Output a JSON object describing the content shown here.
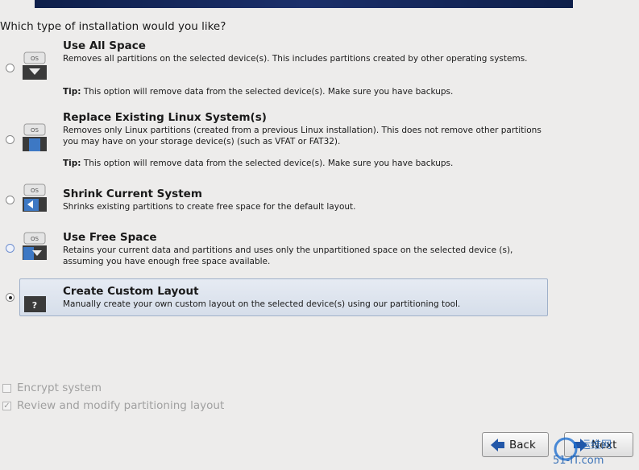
{
  "question": "Which type of installation would you like?",
  "options": [
    {
      "title": "Use All Space",
      "desc": "Removes all partitions on the selected device(s).  This includes partitions created by other operating systems.",
      "tip_label": "Tip:",
      "tip": " This option will remove data from the selected device(s).  Make sure you have backups."
    },
    {
      "title": "Replace Existing Linux System(s)",
      "desc": "Removes only Linux partitions (created from a previous Linux installation).  This does not remove other partitions you may have on your storage device(s) (such as VFAT or FAT32).",
      "tip_label": "Tip:",
      "tip": " This option will remove data from the selected device(s).  Make sure you have backups."
    },
    {
      "title": "Shrink Current System",
      "desc": "Shrinks existing partitions to create free space for the default layout."
    },
    {
      "title": "Use Free Space",
      "desc": "Retains your current data and partitions and uses only the unpartitioned space on the selected device (s), assuming you have enough free space available."
    },
    {
      "title": "Create Custom Layout",
      "desc": "Manually create your own custom layout on the selected device(s) using our partitioning tool.",
      "selected": true
    }
  ],
  "icon_text": {
    "os": "OS",
    "custom": "?"
  },
  "checkboxes": {
    "encrypt": "Encrypt system",
    "review": "Review and modify partitioning layout"
  },
  "buttons": {
    "back": "Back",
    "next": "Next"
  },
  "watermark": {
    "line1": "运维网",
    "line2": "51-IT.com"
  },
  "colors": {
    "banner": "#142659",
    "selection": "#dbe2ee",
    "accent": "#1e4fa0"
  }
}
